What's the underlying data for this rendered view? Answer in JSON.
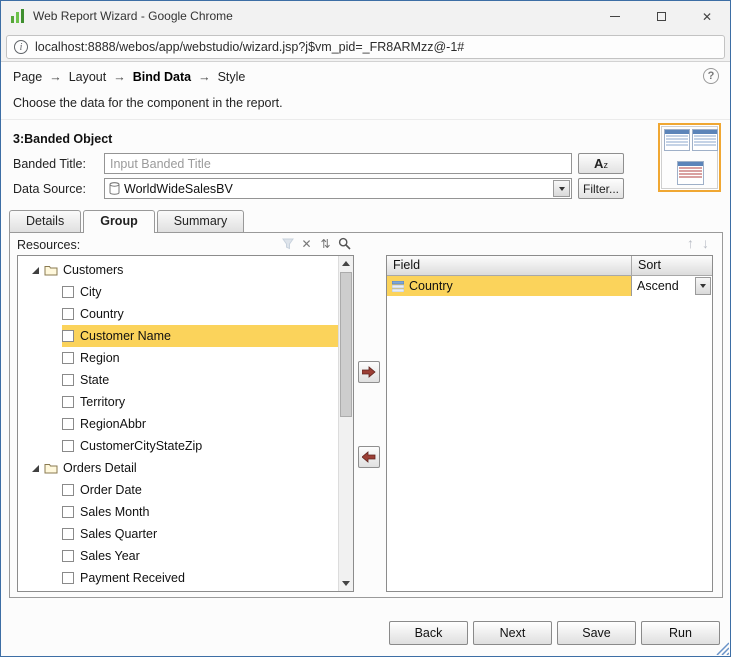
{
  "colors": {
    "selection": "#FBD35B",
    "preview_highlight": "#F0A732",
    "window_border": "#3D6EA5"
  },
  "icons": {
    "info": "i",
    "help": "?",
    "close": "✕",
    "clear": "✕",
    "sort": "⇅",
    "move_up": "↑",
    "move_down": "↓"
  },
  "window": {
    "title": "Web Report Wizard - Google Chrome",
    "url": "localhost:8888/webos/app/webstudio/wizard.jsp?j$vm_pid=_FR8ARMzz@-1#"
  },
  "breadcrumb": {
    "items": [
      "Page",
      "Layout",
      "Bind Data",
      "Style"
    ],
    "active": "Bind Data",
    "separator": "→"
  },
  "description": "Choose the data for the component in the report.",
  "section": {
    "title": "3:Banded Object",
    "banded_title_label": "Banded Title:",
    "banded_title_placeholder": "Input Banded Title",
    "font_button": {
      "a": "A",
      "z": "z"
    },
    "data_source_label": "Data Source:",
    "data_source_value": "WorldWideSalesBV",
    "filter_button_label": "Filter..."
  },
  "tabs": [
    {
      "label": "Details",
      "active": false
    },
    {
      "label": "Group",
      "active": true
    },
    {
      "label": "Summary",
      "active": false
    }
  ],
  "resources": {
    "label": "Resources:",
    "folders": [
      {
        "label": "Customers",
        "expanded": true,
        "children": [
          {
            "label": "City",
            "checked": false
          },
          {
            "label": "Country",
            "checked": false
          },
          {
            "label": "Customer Name",
            "checked": false,
            "selected": true
          },
          {
            "label": "Region",
            "checked": false
          },
          {
            "label": "State",
            "checked": false
          },
          {
            "label": "Territory",
            "checked": false
          },
          {
            "label": "RegionAbbr",
            "checked": false
          },
          {
            "label": "CustomerCityStateZip",
            "checked": false
          }
        ]
      },
      {
        "label": "Orders Detail",
        "expanded": true,
        "children": [
          {
            "label": "Order Date",
            "checked": false
          },
          {
            "label": "Sales Month",
            "checked": false
          },
          {
            "label": "Sales Quarter",
            "checked": false
          },
          {
            "label": "Sales Year",
            "checked": false
          },
          {
            "label": "Payment Received",
            "checked": false
          }
        ]
      }
    ]
  },
  "group_table": {
    "columns": [
      "Field",
      "Sort"
    ],
    "rows": [
      {
        "field": "Country",
        "sort": "Ascend",
        "selected": true
      }
    ]
  },
  "footer": {
    "buttons": [
      "Back",
      "Next",
      "Save",
      "Run"
    ]
  }
}
